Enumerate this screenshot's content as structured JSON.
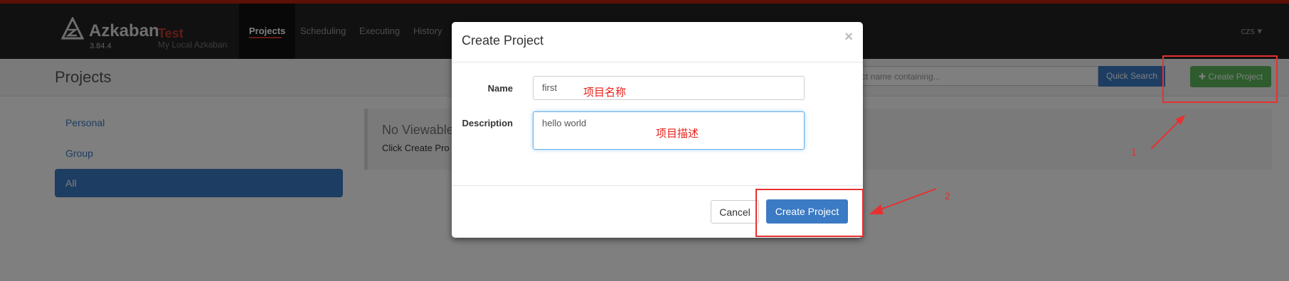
{
  "navbar": {
    "brand_name": "Azkaban",
    "brand_env": "Test",
    "brand_version": "3.84.4",
    "brand_subtitle": "My Local Azkaban",
    "tabs": [
      "Projects",
      "Scheduling",
      "Executing",
      "History"
    ],
    "user": "czs ▾"
  },
  "subheader": {
    "title": "Projects",
    "search_placeholder": "roject name containing...",
    "quick_search_label": "Quick Search",
    "create_project_label": "✚ Create Project"
  },
  "sidebar": {
    "items": [
      "Personal",
      "Group",
      "All"
    ]
  },
  "content": {
    "title": "No Viewable",
    "text": "Click Create Pro"
  },
  "modal": {
    "title": "Create Project",
    "close": "×",
    "name_label": "Name",
    "name_value": "first",
    "name_annotation": "项目名称",
    "description_label": "Description",
    "description_value": "hello world",
    "description_annotation": "项目描述",
    "cancel_label": "Cancel",
    "create_label": "Create Project"
  },
  "annotations": {
    "step1": "1",
    "step2": "2"
  },
  "colors": {
    "accent_red": "#b8200f",
    "primary_blue": "#3b7ac4",
    "success_green": "#5cb85c",
    "annotation_red": "#e83030"
  }
}
